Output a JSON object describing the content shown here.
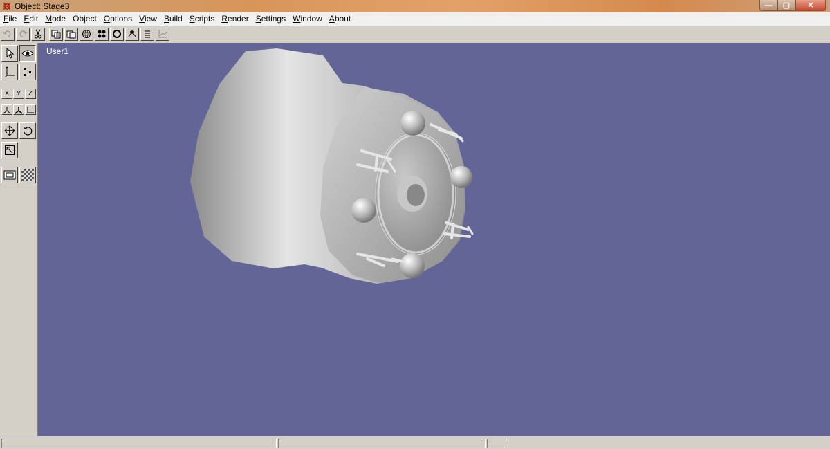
{
  "window": {
    "title": "Object: Stage3",
    "controls": {
      "minimize": "—",
      "maximize": "▢",
      "close": "✕"
    }
  },
  "menu": [
    {
      "label": "File",
      "mnemonic": "F"
    },
    {
      "label": "Edit",
      "mnemonic": "E"
    },
    {
      "label": "Mode",
      "mnemonic": "M"
    },
    {
      "label": "Object",
      "mnemonic": ""
    },
    {
      "label": "Options",
      "mnemonic": "O"
    },
    {
      "label": "View",
      "mnemonic": "V"
    },
    {
      "label": "Build",
      "mnemonic": "B"
    },
    {
      "label": "Scripts",
      "mnemonic": "S"
    },
    {
      "label": "Render",
      "mnemonic": "R"
    },
    {
      "label": "Settings",
      "mnemonic": "S"
    },
    {
      "label": "Window",
      "mnemonic": "W"
    },
    {
      "label": "About",
      "mnemonic": "A"
    }
  ],
  "toolbar": {
    "icons": [
      "undo-icon",
      "redo-icon",
      "cut-icon",
      "copy-icon",
      "paste-icon",
      "sphere-icon",
      "vertices-icon",
      "circle-icon",
      "add-point-icon",
      "list-icon",
      "graph-icon"
    ]
  },
  "palette": {
    "axes": {
      "x": "X",
      "y": "Y",
      "z": "Z"
    }
  },
  "viewport": {
    "label": "User1",
    "background": "#636597"
  }
}
